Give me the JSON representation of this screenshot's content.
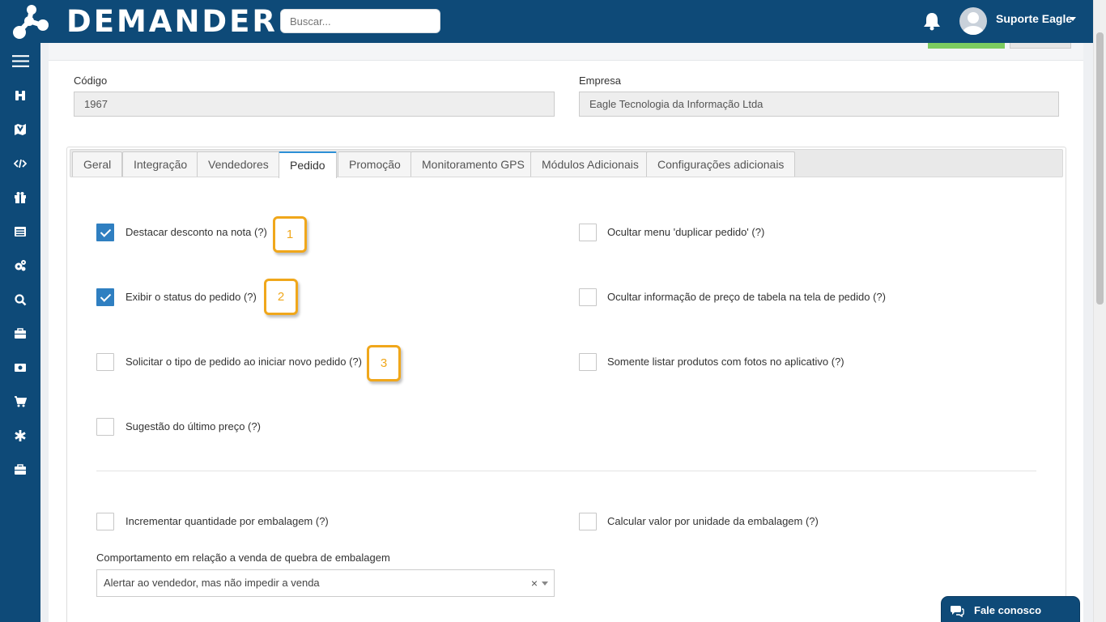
{
  "header": {
    "brand": "DEMANDER",
    "search_placeholder": "Buscar...",
    "user_name": "Suporte Eagle"
  },
  "sidebar": {
    "items": [
      {
        "icon": "menu-icon"
      },
      {
        "icon": "binoculars-icon"
      },
      {
        "icon": "map-icon"
      },
      {
        "icon": "code-icon"
      },
      {
        "icon": "gift-icon"
      },
      {
        "icon": "list-icon"
      },
      {
        "icon": "cogs-icon"
      },
      {
        "icon": "search-icon"
      },
      {
        "icon": "briefcase-icon"
      },
      {
        "icon": "money-icon"
      },
      {
        "icon": "cart-icon"
      },
      {
        "icon": "asterisk-icon"
      },
      {
        "icon": "briefcase-icon"
      }
    ]
  },
  "form": {
    "codigo_label": "Código",
    "codigo_value": "1967",
    "empresa_label": "Empresa",
    "empresa_value": "Eagle Tecnologia da Informação Ltda"
  },
  "tabs": [
    {
      "label": "Geral"
    },
    {
      "label": "Integração"
    },
    {
      "label": "Vendedores"
    },
    {
      "label": "Pedido",
      "active": true
    },
    {
      "label": "Promoção"
    },
    {
      "label": "Monitoramento GPS"
    },
    {
      "label": "Módulos Adicionais"
    },
    {
      "label": "Configurações adicionais"
    }
  ],
  "options": {
    "destacar_desconto": {
      "label": "Destacar desconto na nota (?)",
      "checked": true
    },
    "ocultar_duplicar": {
      "label": "Ocultar menu 'duplicar pedido' (?)",
      "checked": false
    },
    "exibir_status": {
      "label": "Exibir o status do pedido (?)",
      "checked": true
    },
    "ocultar_preco_tabela": {
      "label": "Ocultar informação de preço de tabela na tela de pedido (?)",
      "checked": false
    },
    "solicitar_tipo": {
      "label": "Solicitar o tipo de pedido ao iniciar novo pedido (?)",
      "checked": false
    },
    "somente_fotos": {
      "label": "Somente listar produtos com fotos no aplicativo (?)",
      "checked": false
    },
    "sugestao_preco": {
      "label": "Sugestão do último preço (?)",
      "checked": false
    },
    "incrementar_qtd": {
      "label": "Incrementar quantidade por embalagem (?)",
      "checked": false
    },
    "calcular_valor": {
      "label": "Calcular valor por unidade da embalagem (?)",
      "checked": false
    }
  },
  "markers": [
    "1",
    "2",
    "3"
  ],
  "quebra": {
    "label": "Comportamento em relação a venda de quebra de embalagem",
    "selected": "Alertar ao vendedor, mas não impedir a venda",
    "clear": "×"
  },
  "chat": {
    "label": "Fale conosco"
  },
  "colors": {
    "primary": "#0e4a78",
    "checkbox": "#2f7fc1",
    "marker": "#f0a71b",
    "active_tab_top": "#2c8fd6"
  }
}
